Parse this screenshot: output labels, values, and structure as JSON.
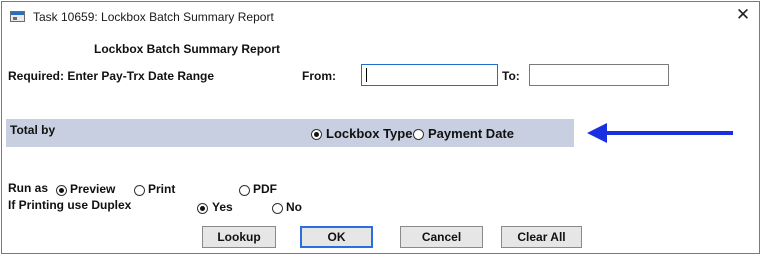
{
  "window": {
    "title": "Task 10659: Lockbox Batch Summary Report",
    "close_glyph": "✕"
  },
  "report": {
    "heading": "Lockbox Batch Summary Report"
  },
  "date_range": {
    "required_label": "Required: Enter Pay-Trx Date Range",
    "from_label": "From:",
    "from_value": "",
    "to_label": "To:",
    "to_value": ""
  },
  "total_by": {
    "label": "Total by",
    "options": [
      {
        "label": "Lockbox Type",
        "selected": true
      },
      {
        "label": "Payment Date",
        "selected": false
      }
    ]
  },
  "annotation": {
    "arrow_color": "#1a2fe0",
    "arrow_icon": "arrow-left-icon"
  },
  "run_as": {
    "label": "Run as",
    "options": [
      {
        "label": "Preview",
        "selected": true
      },
      {
        "label": "Print",
        "selected": false
      },
      {
        "label": "PDF",
        "selected": false
      }
    ]
  },
  "duplex": {
    "label": "If Printing use Duplex",
    "options": [
      {
        "label": "Yes",
        "selected": true
      },
      {
        "label": "No",
        "selected": false
      }
    ]
  },
  "buttons": {
    "lookup": "Lookup",
    "ok": "OK",
    "cancel": "Cancel",
    "clear_all": "Clear All"
  },
  "colors": {
    "band": "#c8cfe0",
    "focus_border": "#1f6fcf",
    "default_button_border": "#2a6fdf"
  }
}
